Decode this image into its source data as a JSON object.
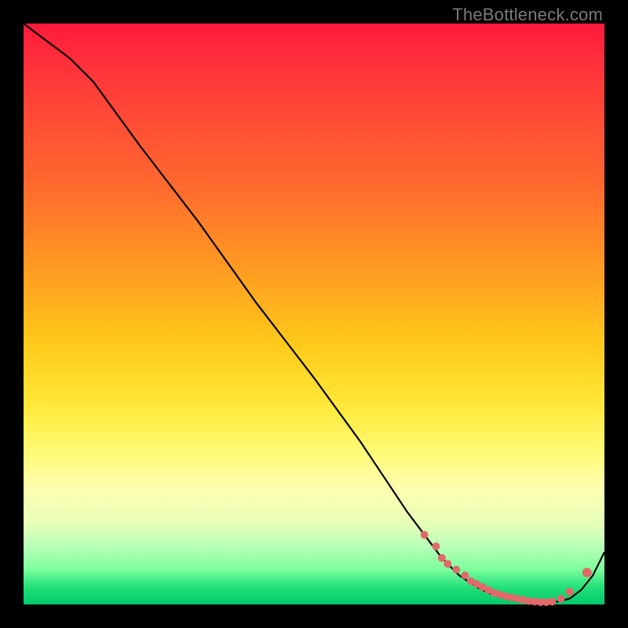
{
  "watermark": {
    "text": "TheBottleneck.com"
  },
  "chart_data": {
    "type": "line",
    "title": "",
    "xlabel": "",
    "ylabel": "",
    "xlim": [
      0,
      100
    ],
    "ylim": [
      0,
      100
    ],
    "series": [
      {
        "name": "bottleneck-curve",
        "x": [
          0,
          4,
          8,
          12,
          20,
          30,
          40,
          50,
          58,
          62,
          66,
          69,
          72,
          75,
          78,
          80,
          83,
          86,
          88,
          90,
          92,
          94,
          96,
          98,
          100
        ],
        "y": [
          100,
          97,
          94,
          90,
          79,
          66,
          52,
          39,
          28,
          22,
          16,
          12,
          8,
          5,
          3,
          2,
          1,
          0.5,
          0.4,
          0.4,
          0.5,
          1,
          2.5,
          5,
          9
        ]
      }
    ],
    "markers": {
      "name": "highlight-dots",
      "color": "#e06a6a",
      "x": [
        69,
        71,
        72,
        73,
        74.5,
        76,
        77,
        78,
        79,
        80,
        81,
        82,
        83,
        84,
        85,
        86,
        87,
        88,
        89,
        90,
        91,
        92.5,
        94,
        97
      ],
      "y": [
        12,
        10,
        8,
        7,
        6,
        5,
        4,
        3.5,
        3,
        2.5,
        2,
        1.7,
        1.4,
        1.2,
        1,
        0.8,
        0.6,
        0.5,
        0.4,
        0.4,
        0.5,
        1,
        2.2,
        5.5
      ],
      "r": [
        5,
        5,
        5,
        5,
        5,
        5,
        5,
        5,
        5,
        5,
        5,
        5,
        5,
        5,
        5,
        5,
        5,
        5,
        5,
        5,
        5,
        5,
        5,
        6
      ]
    }
  }
}
